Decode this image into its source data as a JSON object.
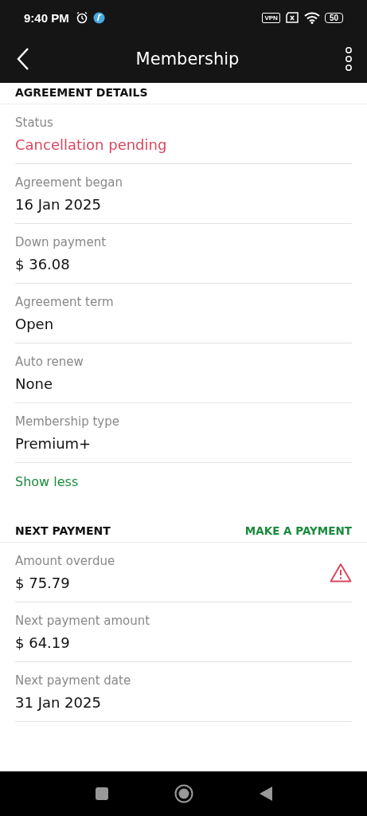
{
  "status_bar": {
    "time": "9:40 PM",
    "battery": "50",
    "vpn": "VPN"
  },
  "app_bar": {
    "title": "Membership"
  },
  "agreement_details": {
    "title": "AGREEMENT DETAILS",
    "rows": [
      {
        "label": "Status",
        "value": "Cancellation pending",
        "alert": true
      },
      {
        "label": "Agreement began",
        "value": "16 Jan 2025",
        "alert": false
      },
      {
        "label": "Down payment",
        "value": "$ 36.08",
        "alert": false
      },
      {
        "label": "Agreement term",
        "value": "Open",
        "alert": false
      },
      {
        "label": "Auto renew",
        "value": "None",
        "alert": false
      },
      {
        "label": "Membership type",
        "value": "Premium+",
        "alert": false
      }
    ],
    "toggle_link": "Show less"
  },
  "next_payment": {
    "title": "NEXT PAYMENT",
    "action": "MAKE A PAYMENT",
    "rows": [
      {
        "label": "Amount overdue",
        "value": "$ 75.79",
        "warning": true
      },
      {
        "label": "Next payment amount",
        "value": "$ 64.19",
        "warning": false
      },
      {
        "label": "Next payment date",
        "value": "31 Jan 2025",
        "warning": false
      }
    ]
  }
}
